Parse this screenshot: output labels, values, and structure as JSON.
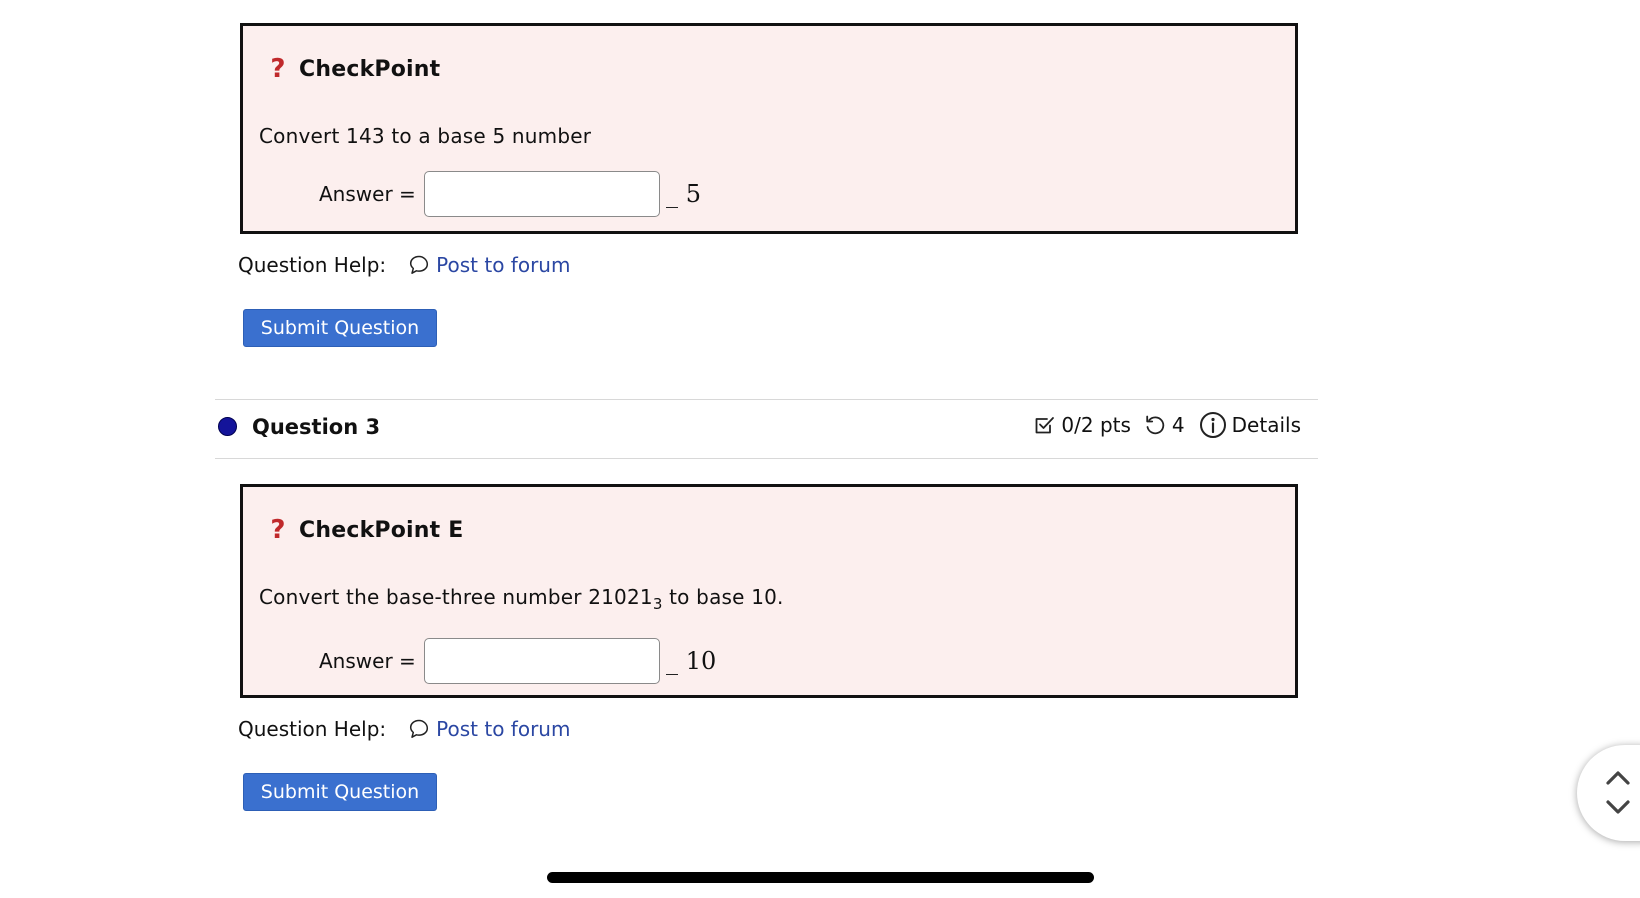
{
  "question_2": {
    "title": "CheckPoint",
    "prompt": "Convert 143 to a base 5 number",
    "answer_label": "Answer =",
    "answer_value": "",
    "base": "5",
    "help_label": "Question Help:",
    "forum_link": "Post to forum",
    "submit_label": "Submit Question"
  },
  "question_3_header": {
    "title": "Question 3",
    "points": "0/2 pts",
    "attempts": "4",
    "details": "Details"
  },
  "question_3": {
    "title": "CheckPoint E",
    "prompt_prefix": "Convert the base-three number 21021",
    "prompt_subscript": "3",
    "prompt_suffix": " to base 10.",
    "answer_label": "Answer =",
    "answer_value": "",
    "base": "10",
    "help_label": "Question Help:",
    "forum_link": "Post to forum",
    "submit_label": "Submit Question"
  },
  "icons": {
    "question": "?",
    "forum": "speech-bubble-icon",
    "points": "checkbox-icon",
    "attempts": "retry-icon",
    "details": "info-icon",
    "scroll_up": "chevron-up-icon",
    "scroll_down": "chevron-down-icon"
  },
  "colors": {
    "question_box_bg": "#fcefee",
    "question_mark": "#c0292b",
    "link": "#2b47a3",
    "submit_button": "#3a70cf",
    "status_dot": "#14149a"
  }
}
